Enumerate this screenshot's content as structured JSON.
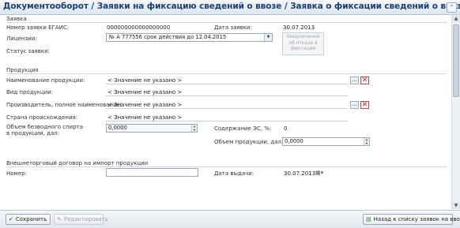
{
  "header": {
    "title": "Документооборот / Заявки на фиксацию сведений о ввозе / Заявка о фиксации сведений о ввозе ЭС"
  },
  "request": {
    "section_label": "Заявка",
    "number_label": "Номер заявки ЕГАИС:",
    "number_value": "000000000000000000",
    "date_label": "Дата заявки:",
    "date_value": "30.07.2013",
    "license_label": "Лицензии:",
    "license_value": "№ А 777556 срок действия до 12.04.2015",
    "status_label": "Статус заявки:",
    "rejection_notice": "Уведомление об отказе в фиксации"
  },
  "product": {
    "section_label": "Продукция",
    "name_label": "Наименование продукции:",
    "name_value": "< Значение не указано >",
    "type_label": "Вид продукции:",
    "type_value": "< Значение не указано >",
    "producer_label": "Производитель, полное наименование:",
    "producer_value": "< Значение не указано >",
    "country_label": "Страна происхождения:",
    "country_value": "< Значение не указано >",
    "volume_spirit_label_1": "Объем безводного спирта",
    "volume_spirit_label_2": "в продукции, дал:",
    "volume_spirit_value": "0,0000",
    "es_content_label": "Содержание ЭС, %:",
    "es_content_value": "0",
    "volume_label": "Объем продукции, дал:",
    "volume_value": "0,0000"
  },
  "contract": {
    "section_label": "Внешнеторговый договор на импорт продукции",
    "number_label": "Номер:",
    "number_value": "",
    "issue_date_label": "Дата выдачи:",
    "issue_date_value": "30.07.2013"
  },
  "footer": {
    "save_label": "Сохранить",
    "edit_label": "Редактировать",
    "back_label": "Назад к списку заявок на ввоз"
  },
  "icons": {
    "save": "checkmark-icon",
    "edit": "pencil-icon",
    "back": "back-list-icon",
    "clear": "red-x-icon",
    "select": "ellipsis-icon",
    "calendar": "calendar-icon"
  }
}
